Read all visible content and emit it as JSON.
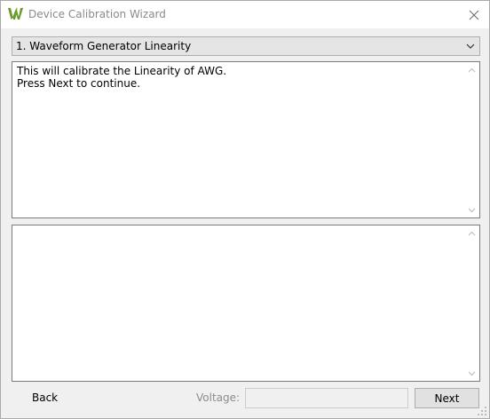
{
  "window": {
    "title": "Device Calibration Wizard",
    "logo_icon": "w-logo-icon",
    "close_icon": "close-icon"
  },
  "step_selector": {
    "selected": "1. Waveform Generator Linearity",
    "options": [
      "1. Waveform Generator Linearity"
    ]
  },
  "instructions": {
    "text": "This will calibrate the Linearity of AWG.\nPress Next to continue."
  },
  "log": {
    "text": ""
  },
  "footer": {
    "back_label": "Back",
    "voltage_label": "Voltage:",
    "voltage_value": "",
    "next_label": "Next"
  },
  "colors": {
    "logo_green": "#6a9a2a",
    "logo_yellow": "#d8b020",
    "title_text": "#8a8a8a",
    "disabled_text": "#8c8c8c"
  }
}
